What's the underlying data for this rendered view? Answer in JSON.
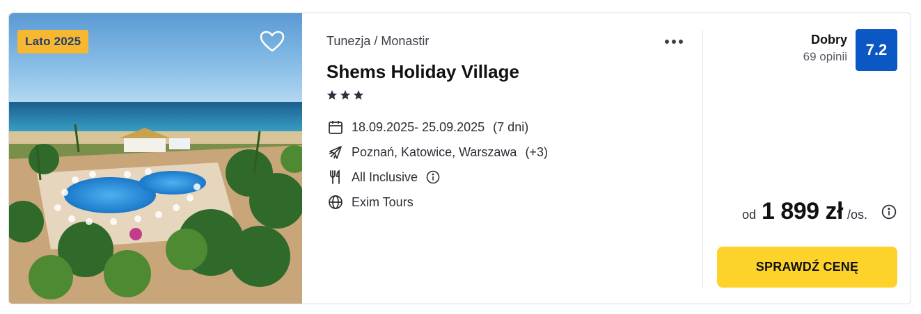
{
  "offer": {
    "season_badge": "Lato 2025",
    "location": "Tunezja / Monastir",
    "hotel_name": "Shems Holiday Village",
    "stars": 3,
    "dates": "18.09.2025- 25.09.2025",
    "duration": "(7 dni)",
    "airports": "Poznań, Katowice, Warszawa",
    "airports_extra": "(+3)",
    "board": "All Inclusive",
    "operator": "Exim Tours",
    "rating_label": "Dobry",
    "rating_count": "69 opinii",
    "rating_score": "7.2",
    "price_prefix": "od",
    "price": "1 899 zł",
    "price_suffix": "/os.",
    "cta_label": "SPRAWDŹ CENĘ"
  },
  "icons": {
    "favorite": "heart-icon",
    "more": "more-dots-icon",
    "star": "star-icon",
    "dates": "calendar-icon",
    "airports": "plane-icon",
    "board": "cutlery-icon",
    "board_info": "info-icon",
    "operator": "globe-icon",
    "price_info": "info-icon"
  },
  "colors": {
    "season_badge_bg": "#f7b731",
    "season_badge_text": "#1f3c73",
    "rating_score_bg": "#0b57c4",
    "cta_bg": "#fdd32b",
    "star": "#2b3340"
  }
}
